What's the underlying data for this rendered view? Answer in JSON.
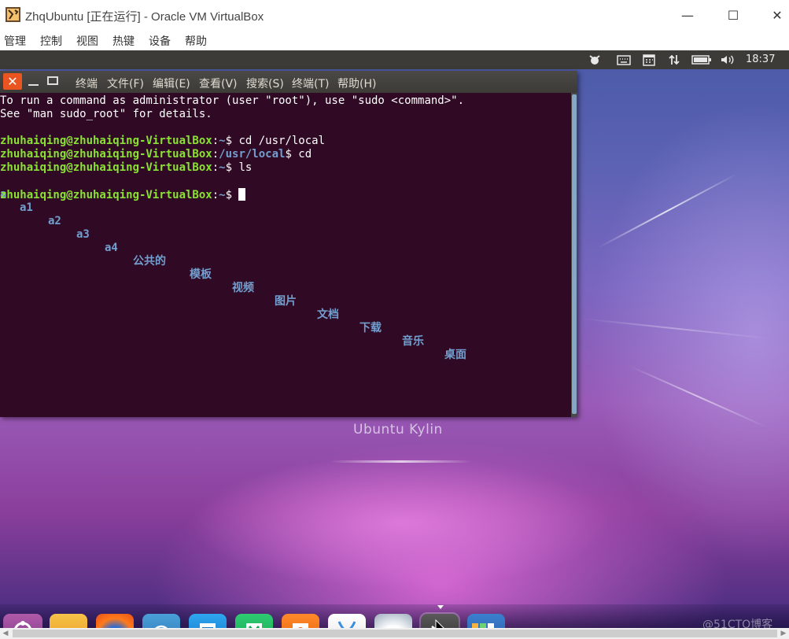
{
  "window": {
    "title": "ZhqUbuntu [正在运行] - Oracle VM VirtualBox",
    "minimize_glyph": "—",
    "maximize_glyph": "☐",
    "close_glyph": "✕"
  },
  "host_menu": [
    "管理",
    "控制",
    "视图",
    "热键",
    "设备",
    "帮助"
  ],
  "ubuntu_panel": {
    "clock": "18:37",
    "indicators": [
      "kylin-indicator-icon",
      "keyboard-icon",
      "calendar-icon",
      "network-icon",
      "battery-icon",
      "volume-icon"
    ]
  },
  "terminal": {
    "close_glyph": "✕",
    "menu": [
      "终端",
      "文件(F)",
      "编辑(E)",
      "查看(V)",
      "搜索(S)",
      "终端(T)",
      "帮助(H)"
    ],
    "lines": [
      "To run a command as administrator (user \"root\"), use \"sudo <command>\".",
      "See \"man sudo_root\" for details."
    ],
    "prompts": [
      {
        "user": "zhuhaiqing@zhuhaiqing-VirtualBox",
        "sep": ":",
        "path": "~",
        "cmd": "$ cd /usr/local"
      },
      {
        "user": "zhuhaiqing@zhuhaiqing-VirtualBox",
        "sep": ":",
        "path": "/usr/local",
        "cmd": "$ cd"
      },
      {
        "user": "zhuhaiqing@zhuhaiqing-VirtualBox",
        "sep": ":",
        "path": "~",
        "cmd": "$ ls"
      },
      {
        "user": "zhuhaiqing@zhuhaiqing-VirtualBox",
        "sep": ":",
        "path": "~",
        "cmd": "$ "
      }
    ],
    "ls_output": [
      "a",
      "a1",
      "a2",
      "a3",
      "a4",
      "公共的",
      "模板",
      "视频",
      "图片",
      "文档",
      "下载",
      "音乐",
      "桌面"
    ]
  },
  "desktop": {
    "distro_label": "Ubuntu Kylin"
  },
  "dock": {
    "items": [
      "dash-icon",
      "files-icon",
      "firefox-icon",
      "software-center-icon",
      "wps-writer-icon",
      "wps-spreadsheet-icon",
      "wps-presentation-icon",
      "app-store-icon",
      "web-browser-icon",
      "terminal-icon",
      "workspaces-icon"
    ]
  },
  "watermark": "@51CTO博客",
  "colors": {
    "terminal_bg": "#300a24",
    "prompt_user": "#8ae234",
    "prompt_path": "#729fcf",
    "ubuntu_orange": "#e95420"
  }
}
